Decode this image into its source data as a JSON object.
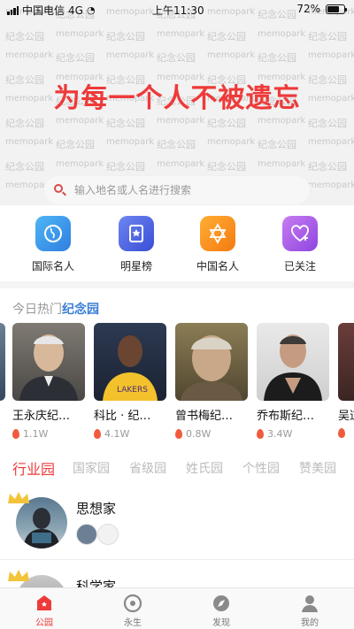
{
  "status_bar": {
    "carrier": "中国电信",
    "network": "4G",
    "time": "上午11:30",
    "battery": "72%",
    "battery_level": 0.72
  },
  "hero": {
    "watermark_en": "memopark",
    "watermark_cn": "纪念公园",
    "slogan": "为每一个人不被遗忘"
  },
  "search": {
    "placeholder": "输入地名或人名进行搜索"
  },
  "categories": [
    {
      "label": "国际名人",
      "icon": "globe-icon"
    },
    {
      "label": "明星榜",
      "icon": "star-badge-icon"
    },
    {
      "label": "中国名人",
      "icon": "star-of-david-icon"
    },
    {
      "label": "已关注",
      "icon": "heart-plus-icon"
    }
  ],
  "hot": {
    "title_prefix": "今日热门",
    "title_accent": "纪念园",
    "cards": [
      {
        "name": "王永庆纪…",
        "heat": "1.1W"
      },
      {
        "name": "科比 · 纪…",
        "heat": "4.1W"
      },
      {
        "name": "曾书梅纪…",
        "heat": "0.8W"
      },
      {
        "name": "乔布斯纪…",
        "heat": "3.4W"
      },
      {
        "name": "吴道",
        "heat": ""
      }
    ]
  },
  "tabs": [
    "行业园",
    "国家园",
    "省级园",
    "姓氏园",
    "个性园",
    "赞美园"
  ],
  "list": [
    {
      "title": "思想家"
    },
    {
      "title": "科学家"
    }
  ],
  "bottom_nav": [
    {
      "label": "公园",
      "icon": "park-icon"
    },
    {
      "label": "永生",
      "icon": "eternal-icon"
    },
    {
      "label": "发现",
      "icon": "discover-icon"
    },
    {
      "label": "我的",
      "icon": "profile-icon"
    }
  ],
  "colors": {
    "accent": "#ee3a3a",
    "link": "#3a7fd6"
  }
}
